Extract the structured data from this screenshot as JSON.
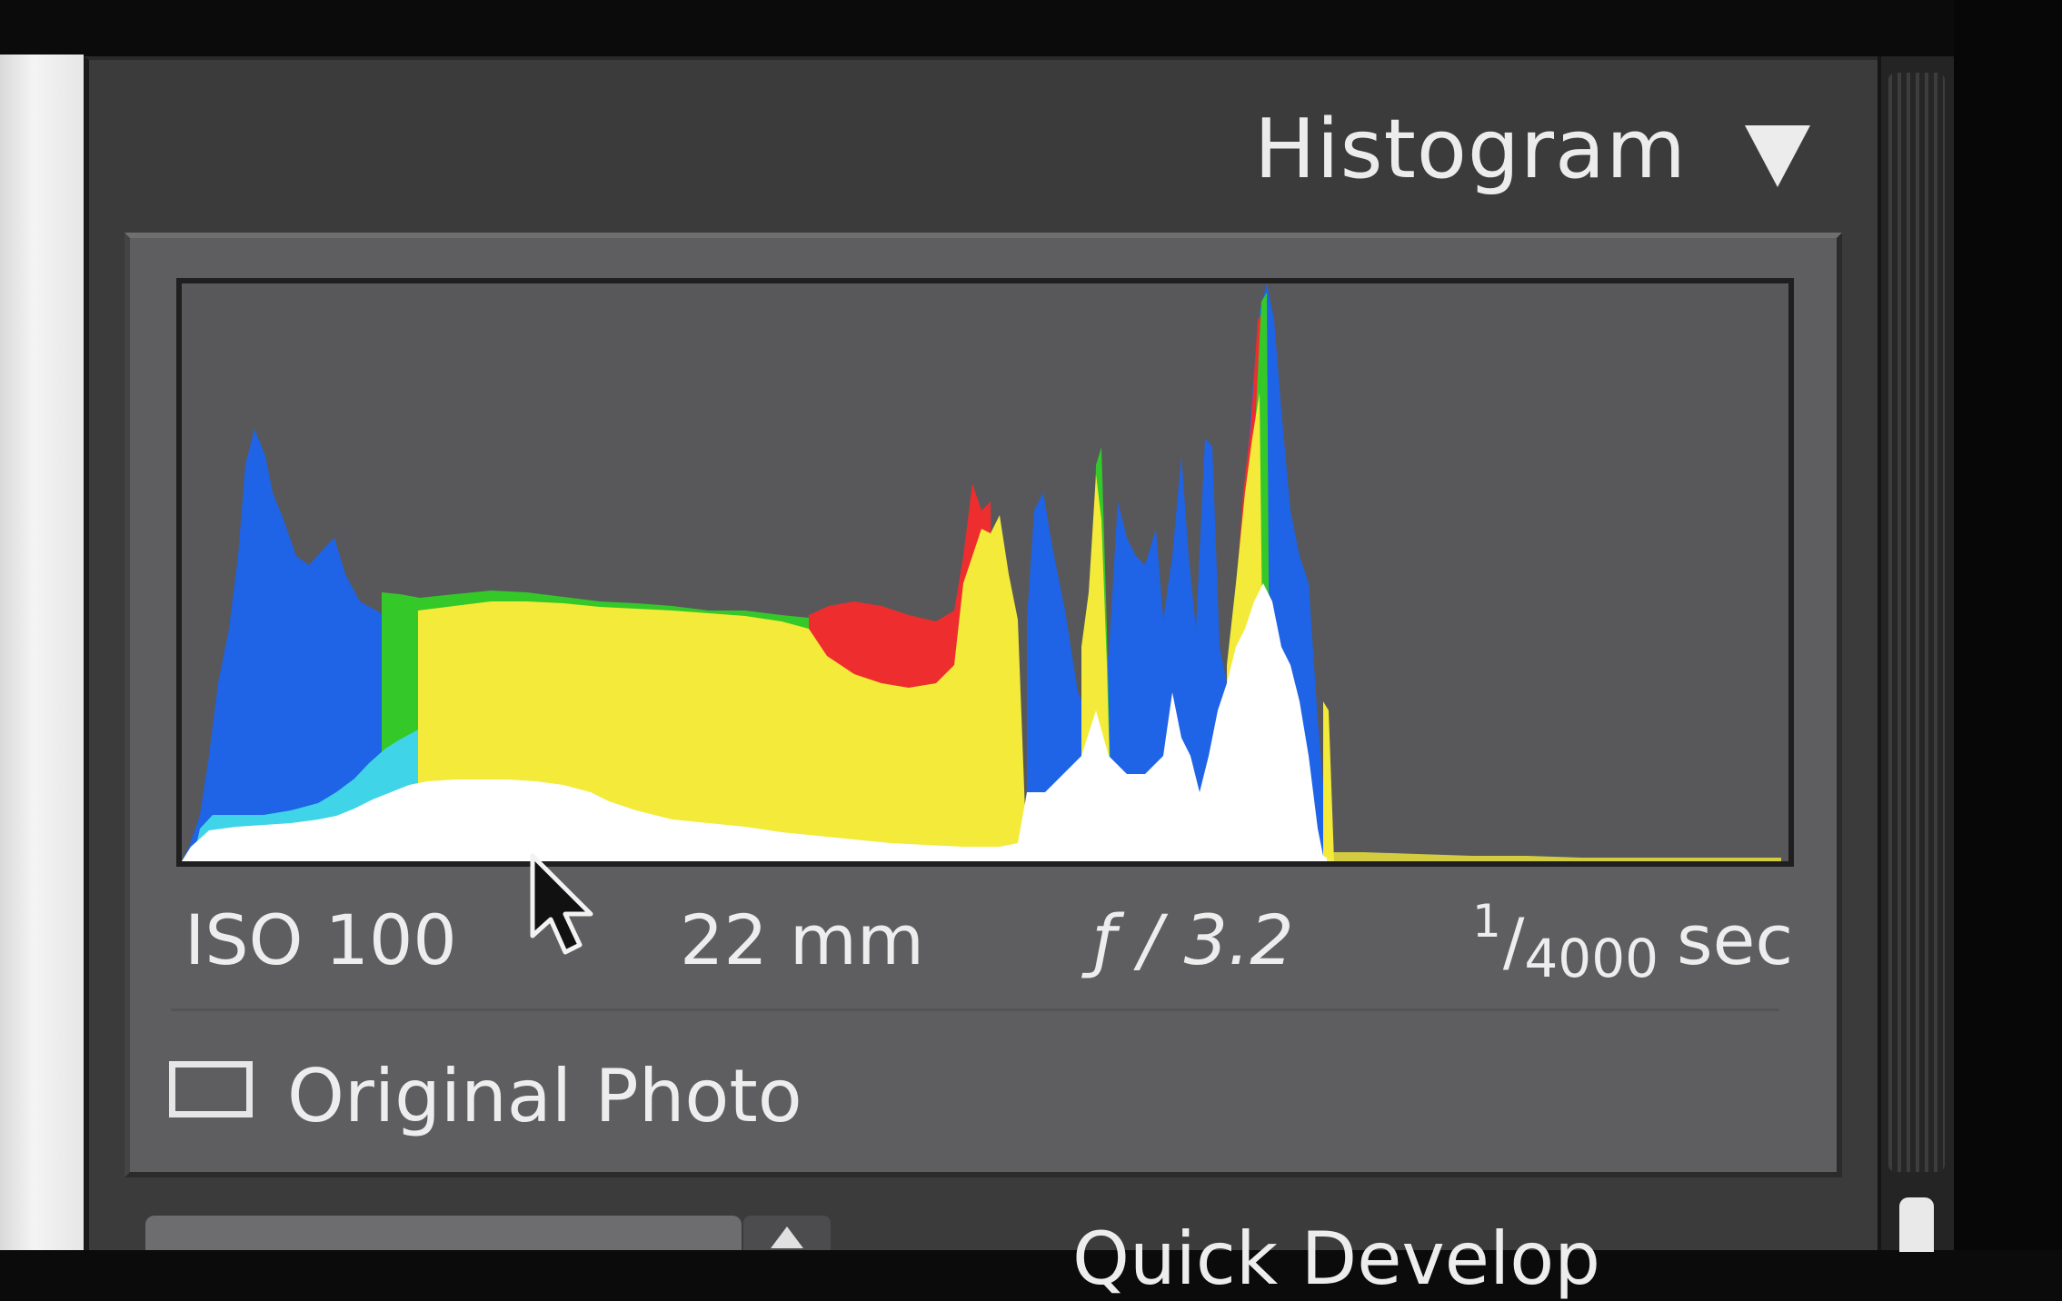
{
  "header": {
    "title": "Histogram"
  },
  "exif": {
    "iso": "ISO 100",
    "focal_length": "22 mm",
    "aperture": "ƒ / 3.2",
    "shutter_numerator": "1",
    "shutter_slash": "/",
    "shutter_denominator": "4000",
    "shutter_unit": "sec"
  },
  "original_photo": {
    "label": "Original Photo",
    "checked": false
  },
  "bottom_bar": {
    "label": "Quick Develop"
  },
  "histogram": {
    "colors": {
      "blue": "#1f63e6",
      "cyan": "#3fd4e8",
      "green": "#35c829",
      "yellow": "#f3ea3a",
      "red": "#ee2d2f",
      "magenta": "#d440d8",
      "white": "#ffffff",
      "background": "#58585a"
    }
  }
}
